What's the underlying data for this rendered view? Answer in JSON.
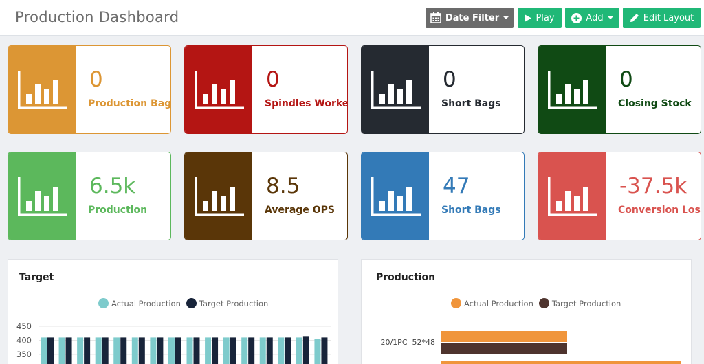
{
  "header": {
    "title": "Production Dashboard",
    "date_filter_label": "Date Filter",
    "play_label": "Play",
    "add_label": "Add",
    "edit_layout_label": "Edit Layout"
  },
  "cards": [
    {
      "value": "0",
      "label": "Production Bags",
      "color": "#dc9634",
      "icon": "bar-chart-icon"
    },
    {
      "value": "0",
      "label": "Spindles Worked",
      "color": "#b41513",
      "icon": "bar-chart-icon"
    },
    {
      "value": "0",
      "label": "Short Bags",
      "color": "#252a31",
      "icon": "bar-chart-icon"
    },
    {
      "value": "0",
      "label": "Closing Stock",
      "color": "#104a14",
      "icon": "bar-chart-icon"
    },
    {
      "value": "6.5k",
      "label": "Production",
      "color": "#5cb85c",
      "icon": "bar-chart-icon"
    },
    {
      "value": "8.5",
      "label": "Average OPS",
      "color": "#5a3608",
      "icon": "bar-chart-icon"
    },
    {
      "value": "47",
      "label": "Short Bags",
      "color": "#337ab7",
      "icon": "bar-chart-icon"
    },
    {
      "value": "-37.5k",
      "label": "Conversion Lost",
      "color": "#d9534f",
      "icon": "bar-chart-icon"
    }
  ],
  "panels": {
    "target": {
      "title": "Target",
      "legend": [
        "Actual Production",
        "Target Production"
      ]
    },
    "production": {
      "title": "Production",
      "legend": [
        "Actual Production",
        "Target Production"
      ]
    }
  },
  "chart_data": [
    {
      "type": "bar",
      "title": "Target",
      "y_ticks": [
        "450",
        "400",
        "350"
      ],
      "ylim": [
        300,
        450
      ],
      "series": [
        {
          "name": "Actual Production",
          "color": "#7ecbcc",
          "values": [
            410,
            410,
            410,
            410,
            410,
            410,
            410,
            410,
            410,
            410,
            410,
            410,
            410,
            410,
            410,
            405
          ]
        },
        {
          "name": "Target Production",
          "color": "#18243a",
          "values": [
            410,
            410,
            410,
            410,
            410,
            410,
            410,
            410,
            410,
            410,
            410,
            410,
            410,
            410,
            415,
            410
          ]
        }
      ]
    },
    {
      "type": "bar",
      "title": "Production",
      "categories": [
        "20/1PC  52*48"
      ],
      "series": [
        {
          "name": "Actual Production",
          "color": "#f0953b"
        },
        {
          "name": "Target Production",
          "color": "#4e342e"
        }
      ]
    }
  ]
}
